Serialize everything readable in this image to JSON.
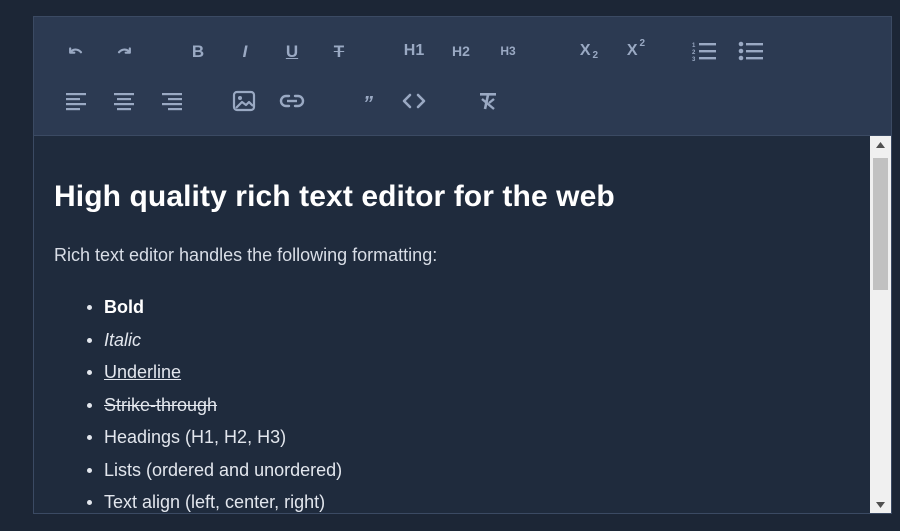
{
  "toolbar": {
    "bold_label": "B",
    "italic_label": "I",
    "underline_label": "U",
    "strike_label": "T",
    "h1_label": "H1",
    "h2_label": "H2",
    "h3_label": "H3",
    "subscript_label": "X",
    "subscript_mark": "2",
    "superscript_label": "X",
    "superscript_mark": "2",
    "quote_label": "”",
    "icons": [
      "undo-icon",
      "redo-icon",
      "ordered-list-icon",
      "bullet-list-icon",
      "align-left-icon",
      "align-center-icon",
      "align-right-icon",
      "image-icon",
      "link-icon",
      "code-icon",
      "clear-format-icon"
    ]
  },
  "content": {
    "heading": "High quality rich text editor for the web",
    "intro": "Rich text editor handles the following formatting:",
    "items": [
      "Bold",
      "Italic",
      "Underline",
      "Strike-through",
      "Headings (H1, H2, H3)",
      "Lists (ordered and unordered)",
      "Text align (left, center, right)"
    ]
  },
  "colors": {
    "page_bg": "#1c2636",
    "toolbar_bg": "#2c3a52",
    "content_bg": "#1f2b3d",
    "icon": "#9aa9c3",
    "text": "#e2e6ed"
  }
}
